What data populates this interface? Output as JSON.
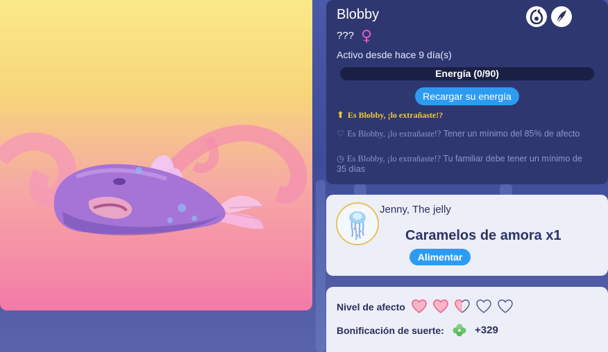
{
  "pet": {
    "name": "Blobby",
    "species": "???",
    "gender_symbol": "♀",
    "active_since": "Activo desde hace 9 día(s)",
    "energy": {
      "label": "Energía (0/90)",
      "current": 0,
      "max": 90
    },
    "recharge_label": "Recargar su energía"
  },
  "evolution": {
    "title": "Es Blobby, ¡lo extrañaste!?",
    "requirements": [
      {
        "icon": "heart-outline-icon",
        "lead": "Es Blobby, ¡lo extrañaste!?",
        "text": "Tener un mínimo del 85% de afecto"
      },
      {
        "icon": "clock-icon",
        "lead": "Es Blobby, ¡lo extrañaste!?",
        "text": "Tu familiar debe tener un mínimo de 35 días"
      }
    ]
  },
  "food": {
    "pet_name": "Jenny, The jelly",
    "item": "Caramelos de amora x1",
    "feed_label": "Alimentar"
  },
  "stats": {
    "affection_label": "Nivel de afecto",
    "affection_hearts": {
      "full": 2,
      "half": 1,
      "empty": 2
    },
    "luck_label": "Bonificación de suerte:",
    "luck_value": "+329"
  },
  "colors": {
    "accent_blue": "#2e9bf2",
    "gold": "#f3c93a",
    "heart_pink": "#f06b8f",
    "gender_pink": "#e85ac8"
  },
  "icons": {
    "top": [
      "egg-swirl-icon",
      "feather-quill-icon"
    ]
  }
}
